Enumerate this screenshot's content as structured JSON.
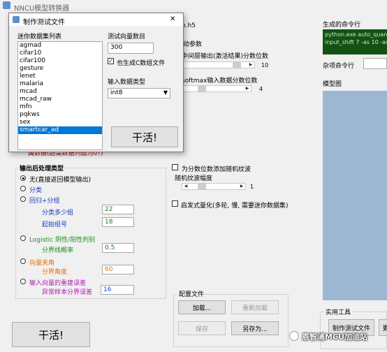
{
  "window": {
    "title": "NNCU模型转换器"
  },
  "main": {
    "file_suffix": "n.h5",
    "quant_group_title": "动参数",
    "mid_layer_label": "中间层输出(激活结果)分数位数",
    "mid_layer_value": "10",
    "softmax_label": "softmax输入数据分数位数",
    "softmax_value": "4",
    "cutoff_text": "属数据(超需数据列面为0?)",
    "random_noise_label": "为分数位数添加随机纹波",
    "noise_amp_label": "随机纹波幅度",
    "noise_amp_value": "1",
    "heuristic_label": "启发式量化(多轮, 慢, 需要迷你数据集)"
  },
  "post": {
    "title": "输出后处理类型",
    "opt_none": "无(直接返回模型输出)",
    "opt_classify": "分类",
    "opt_regress": "回归+分组",
    "group_count_label": "分类多少组",
    "group_count_value": "22",
    "group_start_label": "起始组号",
    "group_start_value": "18",
    "opt_logistic": "Logistic 阴性/阳性判别",
    "threshold_label": "分界线概率",
    "threshold_value": "0.5",
    "opt_angle": "向量夹角",
    "angle_label": "分界角度",
    "angle_value": "60",
    "opt_recon": "输入向量的重建误差",
    "recon_label": "异常样本分界误差",
    "recon_value": "16"
  },
  "bottom": {
    "run_label": "干活!"
  },
  "config": {
    "title": "配置文件",
    "load": "加载...",
    "reload": "重新加载",
    "save": "保存",
    "save_as": "另存为..."
  },
  "right": {
    "cmd_title": "生成的命令行",
    "cmd_line1": "python.exe auto_quant.p",
    "cmd_line2": "input_shift 7 -as 10 -as2",
    "misc_label": "杂项命令行",
    "misc_value": "",
    "model_title": "模型图",
    "tools_title": "实用工具",
    "tool_make_test": "制作测试文件",
    "tool_more": "更"
  },
  "dialog": {
    "title": "制作测试文件",
    "close": "✕",
    "list_title": "迷你数据集列表",
    "datasets": [
      "agmad",
      "cifar10",
      "cifar100",
      "gesture",
      "lenet",
      "malaria",
      "mcad",
      "mcad_raw",
      "mfn",
      "pqkws",
      "sex",
      "smartcar_ad"
    ],
    "selected_index": 11,
    "vec_count_label": "测试向量数目",
    "vec_count_value": "300",
    "also_c_label": "也生成C数组文件",
    "input_type_label": "输入数据类型",
    "input_type_value": "int8",
    "run_label": "干活!"
  },
  "watermark": {
    "text": "恩智浦MCU加油站"
  }
}
